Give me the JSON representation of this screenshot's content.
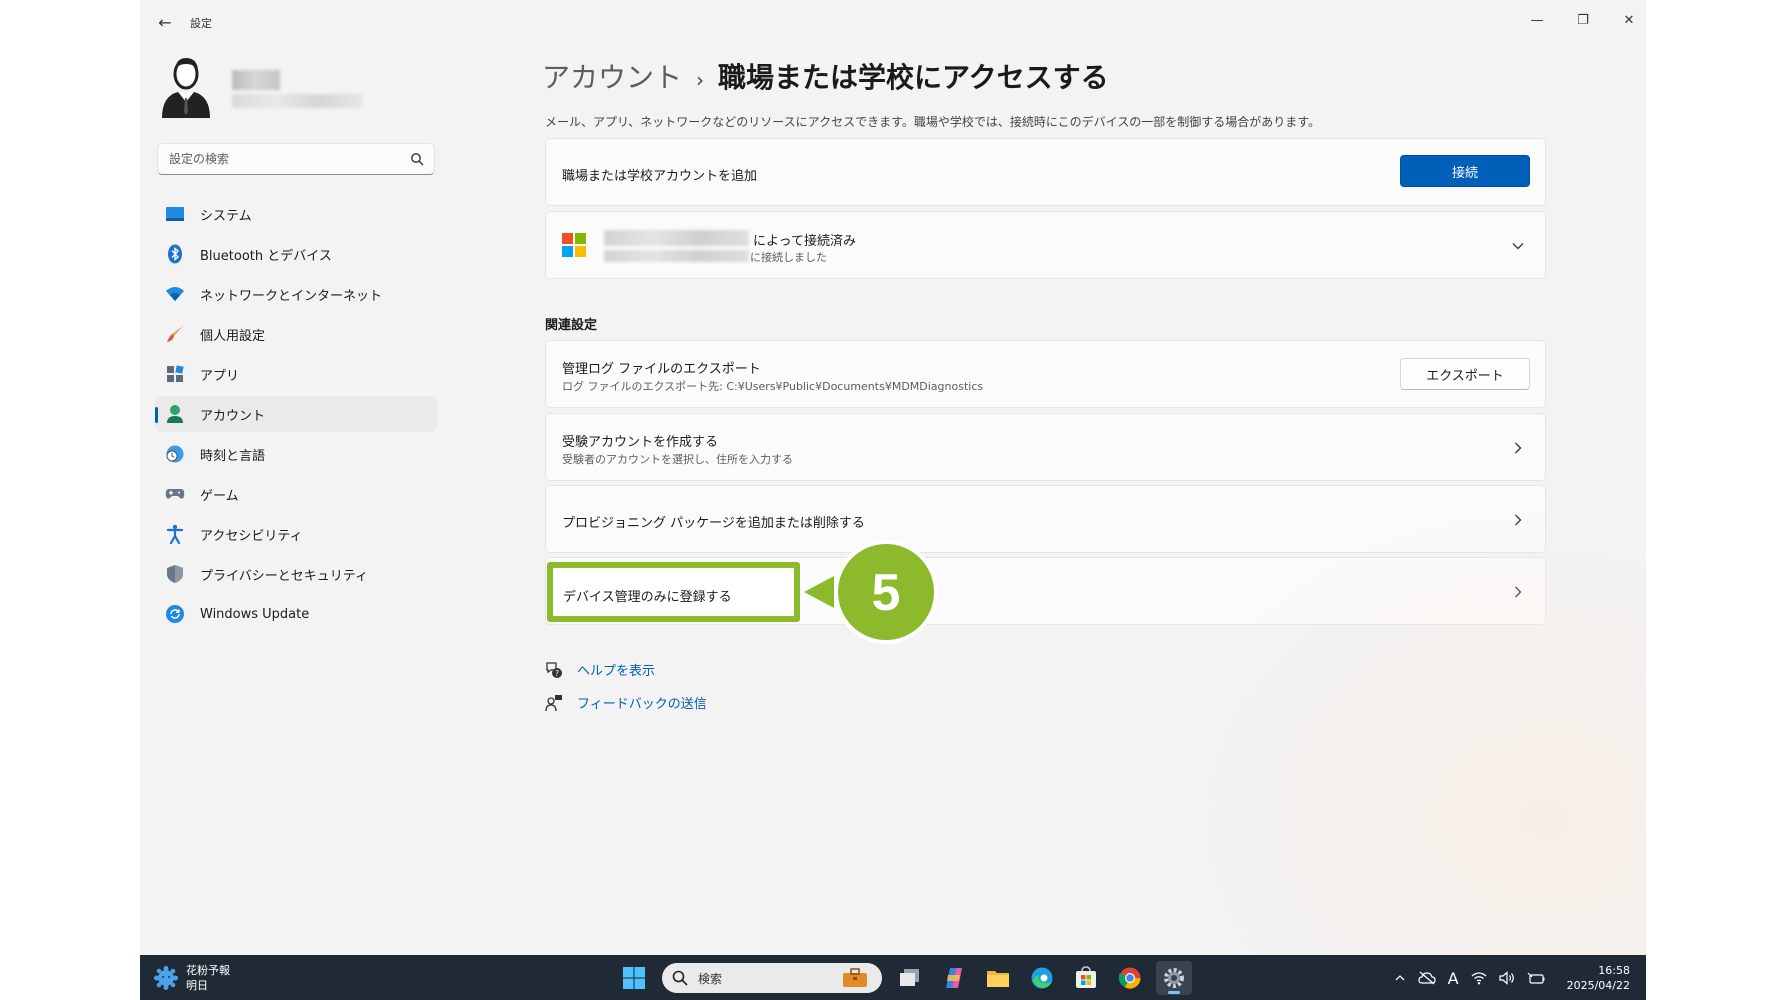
{
  "window": {
    "app_title": "設定",
    "back_glyph": "←",
    "minimize_glyph": "—",
    "maximize_glyph": "❐",
    "close_glyph": "✕"
  },
  "sidebar": {
    "search": {
      "placeholder": "設定の検索"
    },
    "items": [
      {
        "label": "システム",
        "icon": "system-icon"
      },
      {
        "label": "Bluetooth とデバイス",
        "icon": "bluetooth-icon"
      },
      {
        "label": "ネットワークとインターネット",
        "icon": "wifi-icon"
      },
      {
        "label": "個人用設定",
        "icon": "brush-icon"
      },
      {
        "label": "アプリ",
        "icon": "apps-icon"
      },
      {
        "label": "アカウント",
        "icon": "account-icon",
        "active": true
      },
      {
        "label": "時刻と言語",
        "icon": "clock-globe-icon"
      },
      {
        "label": "ゲーム",
        "icon": "gamepad-icon"
      },
      {
        "label": "アクセシビリティ",
        "icon": "accessibility-icon"
      },
      {
        "label": "プライバシーとセキュリティ",
        "icon": "shield-icon"
      },
      {
        "label": "Windows Update",
        "icon": "update-icon"
      }
    ]
  },
  "main": {
    "breadcrumb": {
      "parent": "アカウント",
      "separator": "›",
      "current": "職場または学校にアクセスする"
    },
    "description": "メール、アプリ、ネットワークなどのリソースにアクセスできます。職場や学校では、接続時にこのデバイスの一部を制御する場合があります。",
    "add_account": {
      "title": "職場または学校アカウントを追加",
      "button": "接続"
    },
    "connected_account": {
      "title_suffix": "によって接続済み",
      "sub_suffix": "に接続しました"
    },
    "related_settings": {
      "header": "関連設定",
      "export_logs": {
        "title": "管理ログ ファイルのエクスポート",
        "sub": "ログ ファイルのエクスポート先: C:¥Users¥Public¥Documents¥MDMDiagnostics",
        "button": "エクスポート"
      },
      "test_account": {
        "title": "受験アカウントを作成する",
        "sub": "受験者のアカウントを選択し、住所を入力する"
      },
      "provisioning": {
        "title": "プロビジョニング パッケージを追加または削除する"
      },
      "mdm_only": {
        "title": "デバイス管理のみに登録する"
      }
    },
    "callout_number": "5",
    "links": {
      "help": "ヘルプを表示",
      "feedback": "フィードバックの送信"
    }
  },
  "taskbar": {
    "weather": {
      "title": "花粉予報",
      "sub": "明日"
    },
    "search_label": "検索",
    "time": "16:58",
    "date": "2025/04/22",
    "ime_glyph": "A"
  },
  "colors": {
    "accent": "#005fb8",
    "highlight": "#8dba2c",
    "taskbar": "#202a36"
  }
}
